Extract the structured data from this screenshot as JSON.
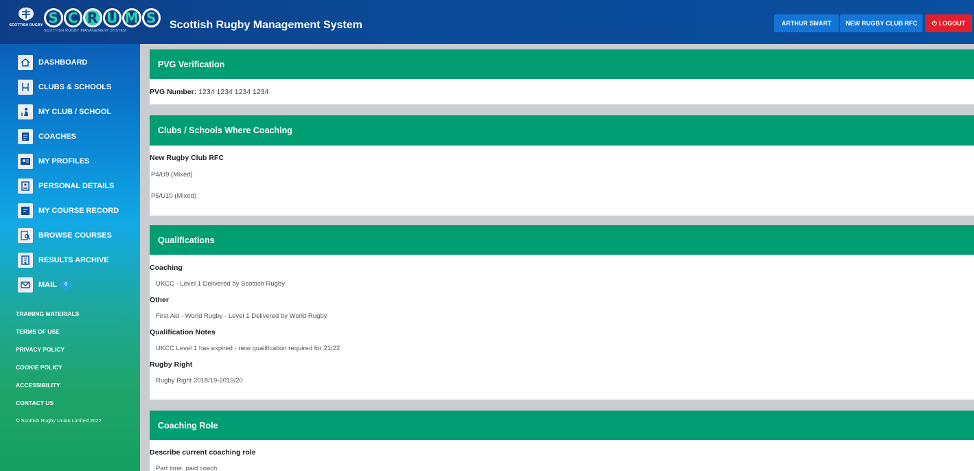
{
  "header": {
    "crest_label": "SCOTTISH RUGBY",
    "logo_letters": [
      "S",
      "C",
      "R",
      "U",
      "M",
      "S"
    ],
    "logo_tagline": "SCOTTISH RUGBY MANAGEMENT SYSTEM",
    "app_title": "Scottish Rugby Management System",
    "user_button": "ARTHUR SMART",
    "club_button": "NEW RUGBY CLUB RFC",
    "logout_button": "LOGOUT"
  },
  "sidebar": {
    "items": [
      {
        "label": "DASHBOARD",
        "icon": "house-icon"
      },
      {
        "label": "CLUBS & SCHOOLS",
        "icon": "rugby-posts-icon"
      },
      {
        "label": "MY CLUB / SCHOOL",
        "icon": "player-icon"
      },
      {
        "label": "COACHES",
        "icon": "clipboard-icon"
      },
      {
        "label": "MY PROFILES",
        "icon": "profile-icon"
      },
      {
        "label": "PERSONAL DETAILS",
        "icon": "id-card-icon"
      },
      {
        "label": "MY COURSE RECORD",
        "icon": "course-record-icon"
      },
      {
        "label": "BROWSE COURSES",
        "icon": "search-document-icon"
      },
      {
        "label": "RESULTS ARCHIVE",
        "icon": "archive-icon"
      },
      {
        "label": "MAIL",
        "icon": "envelope-icon",
        "badge": "0"
      }
    ],
    "footer_links": [
      "TRAINING MATERIALS",
      "TERMS OF USE",
      "PRIVACY POLICY",
      "COOKIE POLICY",
      "ACCESSIBILITY",
      "CONTACT US"
    ],
    "copyright": "© Scottish Rugby Union Limited 2022"
  },
  "pvg": {
    "title": "PVG Verification",
    "number_label": "PVG Number:",
    "number_value": "1234 1234 1234 1234"
  },
  "clubs": {
    "title": "Clubs / Schools Where Coaching",
    "club_name": "New Rugby Club RFC",
    "teams": [
      "P4/U9 (Mixed)",
      "P5/U10 (Mixed)"
    ]
  },
  "qualifications": {
    "title": "Qualifications",
    "sections": [
      {
        "label": "Coaching",
        "value": "UKCC - Level 1 Delivered by Scottish Rugby"
      },
      {
        "label": "Other",
        "value": "First Aid - World Rugby - Level 1 Delivered by World Rugby"
      },
      {
        "label": "Qualification Notes",
        "value": "UKCC Level 1 has expired - new qualification required for 21/22"
      },
      {
        "label": "Rugby Right",
        "value": "Rugby Right 2018/19-2019/20"
      }
    ]
  },
  "coaching_role": {
    "title": "Coaching Role",
    "question": "Describe current coaching role",
    "answer": "Part time, paid coach"
  },
  "colors": {
    "header_blue": "#0b4a97",
    "panel_green": "#029e73",
    "button_blue": "#1374d6",
    "logout_red": "#e31e2d"
  }
}
